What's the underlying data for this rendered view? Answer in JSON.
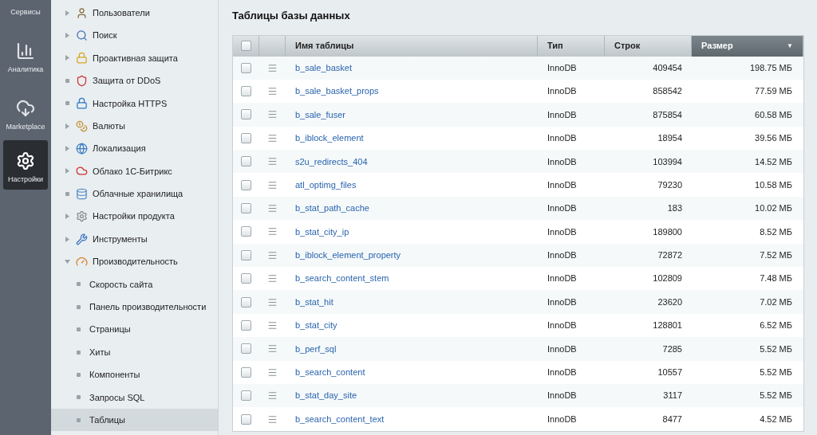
{
  "sidebar": {
    "items": [
      {
        "label": "Сервисы",
        "selected": false
      },
      {
        "label": "Аналитика",
        "selected": false
      },
      {
        "label": "Marketplace",
        "selected": false
      },
      {
        "label": "Настройки",
        "selected": true
      }
    ]
  },
  "nav": {
    "items": [
      {
        "label": "Пользователи",
        "kind": "folder",
        "expanded": false,
        "selected": false
      },
      {
        "label": "Поиск",
        "kind": "folder",
        "expanded": false,
        "selected": false
      },
      {
        "label": "Проактивная защита",
        "kind": "folder",
        "expanded": false,
        "selected": false
      },
      {
        "label": "Защита от DDoS",
        "kind": "leaf",
        "selected": false
      },
      {
        "label": "Настройка HTTPS",
        "kind": "leaf",
        "selected": false
      },
      {
        "label": "Валюты",
        "kind": "folder",
        "expanded": false,
        "selected": false
      },
      {
        "label": "Локализация",
        "kind": "folder",
        "expanded": false,
        "selected": false
      },
      {
        "label": "Облако 1С-Битрикс",
        "kind": "folder",
        "expanded": false,
        "selected": false
      },
      {
        "label": "Облачные хранилища",
        "kind": "leaf",
        "selected": false
      },
      {
        "label": "Настройки продукта",
        "kind": "folder",
        "expanded": false,
        "selected": false
      },
      {
        "label": "Инструменты",
        "kind": "folder",
        "expanded": false,
        "selected": false
      },
      {
        "label": "Производительность",
        "kind": "folder",
        "expanded": true,
        "selected": false,
        "children": [
          {
            "label": "Скорость сайта",
            "selected": false
          },
          {
            "label": "Панель производительности",
            "selected": false
          },
          {
            "label": "Страницы",
            "selected": false
          },
          {
            "label": "Хиты",
            "selected": false
          },
          {
            "label": "Компоненты",
            "selected": false
          },
          {
            "label": "Запросы SQL",
            "selected": false
          },
          {
            "label": "Таблицы",
            "selected": true
          }
        ]
      }
    ]
  },
  "page": {
    "title": "Таблицы базы данных"
  },
  "table": {
    "header_checked": false,
    "columns": [
      {
        "label": "Имя таблицы",
        "sorted": false
      },
      {
        "label": "Тип",
        "sorted": false
      },
      {
        "label": "Строк",
        "sorted": false
      },
      {
        "label": "Размер",
        "sorted": true,
        "sort_mark": "▼"
      }
    ],
    "rows": [
      {
        "checked": false,
        "name": "b_sale_basket",
        "type": "InnoDB",
        "rows": "409454",
        "size": "198.75 МБ"
      },
      {
        "checked": false,
        "name": "b_sale_basket_props",
        "type": "InnoDB",
        "rows": "858542",
        "size": "77.59 МБ"
      },
      {
        "checked": false,
        "name": "b_sale_fuser",
        "type": "InnoDB",
        "rows": "875854",
        "size": "60.58 МБ"
      },
      {
        "checked": false,
        "name": "b_iblock_element",
        "type": "InnoDB",
        "rows": "18954",
        "size": "39.56 МБ"
      },
      {
        "checked": false,
        "name": "s2u_redirects_404",
        "type": "InnoDB",
        "rows": "103994",
        "size": "14.52 МБ"
      },
      {
        "checked": false,
        "name": "atl_optimg_files",
        "type": "InnoDB",
        "rows": "79230",
        "size": "10.58 МБ"
      },
      {
        "checked": false,
        "name": "b_stat_path_cache",
        "type": "InnoDB",
        "rows": "183",
        "size": "10.02 МБ"
      },
      {
        "checked": false,
        "name": "b_stat_city_ip",
        "type": "InnoDB",
        "rows": "189800",
        "size": "8.52 МБ"
      },
      {
        "checked": false,
        "name": "b_iblock_element_property",
        "type": "InnoDB",
        "rows": "72872",
        "size": "7.52 МБ"
      },
      {
        "checked": false,
        "name": "b_search_content_stem",
        "type": "InnoDB",
        "rows": "102809",
        "size": "7.48 МБ"
      },
      {
        "checked": false,
        "name": "b_stat_hit",
        "type": "InnoDB",
        "rows": "23620",
        "size": "7.02 МБ"
      },
      {
        "checked": false,
        "name": "b_stat_city",
        "type": "InnoDB",
        "rows": "128801",
        "size": "6.52 МБ"
      },
      {
        "checked": false,
        "name": "b_perf_sql",
        "type": "InnoDB",
        "rows": "7285",
        "size": "5.52 МБ"
      },
      {
        "checked": false,
        "name": "b_search_content",
        "type": "InnoDB",
        "rows": "10557",
        "size": "5.52 МБ"
      },
      {
        "checked": false,
        "name": "b_stat_day_site",
        "type": "InnoDB",
        "rows": "3117",
        "size": "5.52 МБ"
      },
      {
        "checked": false,
        "name": "b_search_content_text",
        "type": "InnoDB",
        "rows": "8477",
        "size": "4.52 МБ"
      }
    ]
  }
}
